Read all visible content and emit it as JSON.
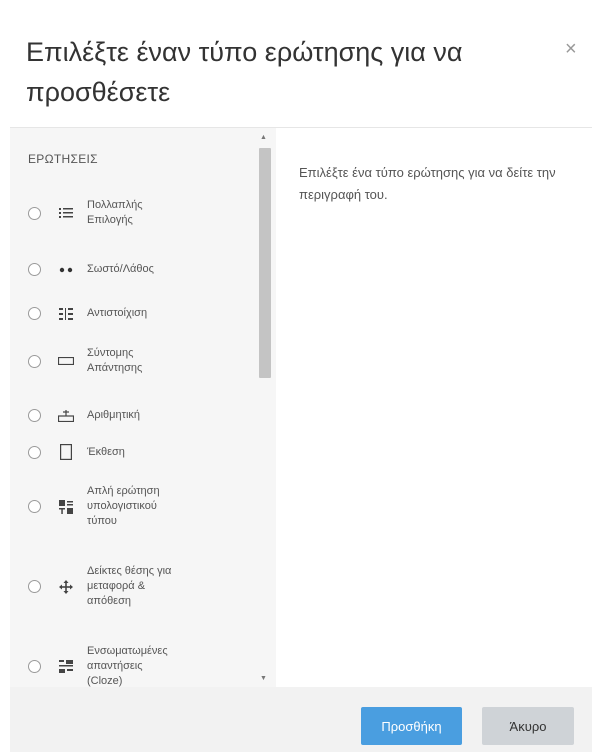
{
  "dialog": {
    "title": "Επιλέξτε έναν τύπο ερώτησης για να προσθέσετε",
    "close_glyph": "×"
  },
  "list": {
    "section_label": "ΕΡΩΤΗΣΕΙΣ",
    "items": [
      {
        "label": "Πολλαπλής Επιλογής",
        "icon": "multiple-choice-icon"
      },
      {
        "label": "Σωστό/Λάθος",
        "icon": "true-false-icon"
      },
      {
        "label": "Αντιστοίχιση",
        "icon": "matching-icon"
      },
      {
        "label": "Σύντομης Απάντησης",
        "icon": "short-answer-icon"
      },
      {
        "label": "Αριθμητική",
        "icon": "numerical-icon"
      },
      {
        "label": "Έκθεση",
        "icon": "essay-icon"
      },
      {
        "label": "Απλή ερώτηση υπολογιστικού τύπου",
        "icon": "calculated-simple-icon"
      },
      {
        "label": "Δείκτες θέσης για μεταφορά & απόθεση",
        "icon": "drag-drop-markers-icon"
      },
      {
        "label": "Ενσωματωμένες απαντήσεις (Cloze)",
        "icon": "cloze-icon"
      }
    ]
  },
  "description": "Επιλέξτε ένα τύπο ερώτησης για να δείτε την περιγραφή του.",
  "footer": {
    "add_label": "Προσθήκη",
    "cancel_label": "Άκυρο"
  },
  "colors": {
    "primary": "#4a9ee0",
    "secondary": "#cfd3d7",
    "panel": "#f6f6f6"
  }
}
